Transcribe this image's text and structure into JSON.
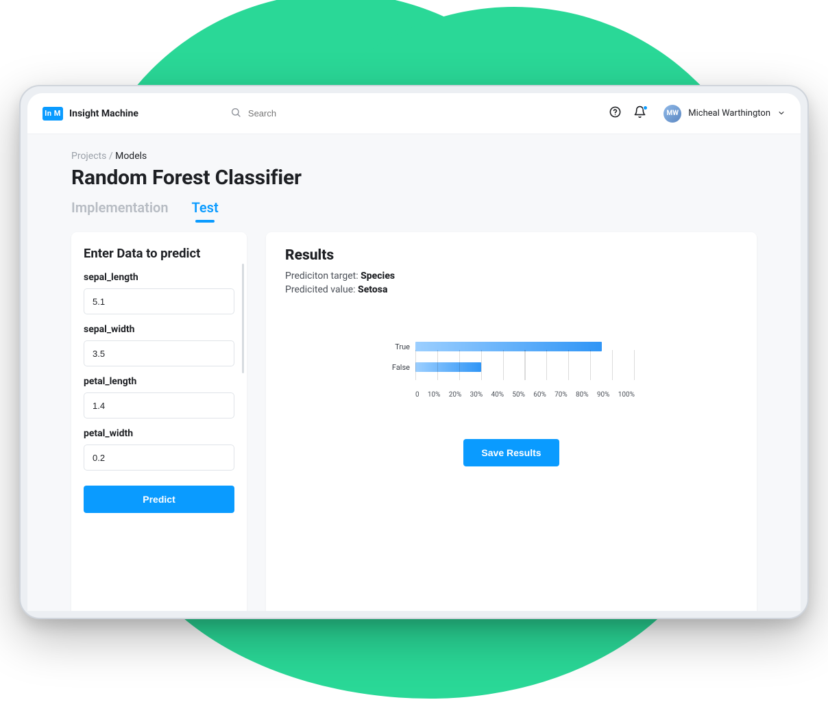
{
  "brand": {
    "badge": "In M",
    "name": "Insight Machine"
  },
  "search": {
    "placeholder": "Search"
  },
  "user": {
    "name": "Micheal Warthington"
  },
  "breadcrumb": {
    "root": "Projects",
    "sep": "/",
    "current": "Models"
  },
  "page_title": "Random Forest Classifier",
  "tabs": [
    {
      "label": "Implementation",
      "active": false
    },
    {
      "label": "Test",
      "active": true
    }
  ],
  "predict_panel": {
    "title": "Enter Data to predict",
    "fields": [
      {
        "name": "sepal_length",
        "value": "5.1"
      },
      {
        "name": "sepal_width",
        "value": "3.5"
      },
      {
        "name": "petal_length",
        "value": "1.4"
      },
      {
        "name": "petal_width",
        "value": "0.2"
      }
    ],
    "submit_label": "Predict"
  },
  "results_panel": {
    "title": "Results",
    "target_label": "Prediciton target:",
    "target_value": "Species",
    "predicted_label": "Predicited value:",
    "predicted_value": "Setosa",
    "save_label": "Save Results"
  },
  "chart_data": {
    "type": "bar",
    "orientation": "horizontal",
    "categories": [
      "True",
      "False"
    ],
    "values": [
      85,
      30
    ],
    "xlabel": "",
    "ylabel": "",
    "xlim": [
      0,
      100
    ],
    "x_ticks": [
      "0",
      "10%",
      "20%",
      "30%",
      "40%",
      "50%",
      "60%",
      "70%",
      "80%",
      "90%",
      "100%"
    ]
  },
  "colors": {
    "accent": "#0a9bff",
    "background_blob": "#2ad897"
  }
}
